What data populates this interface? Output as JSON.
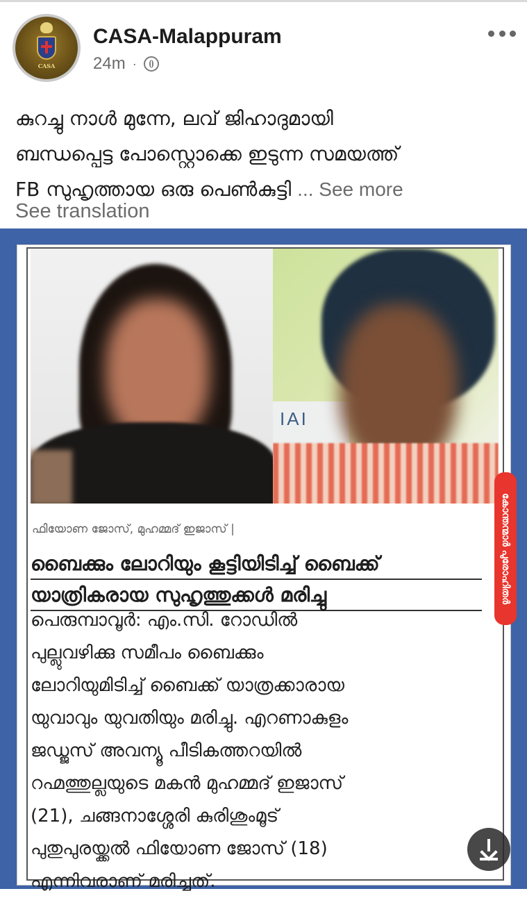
{
  "post": {
    "page_name": "CASA-Malappuram",
    "timestamp": "24m",
    "separator": "·",
    "avatar_text": "CASA",
    "text_line1": "കുറച്ചു നാൾ മുന്നേ, ലവ് ജിഹാദുമായി",
    "text_line2": "ബന്ധപ്പെട്ട പോസ്റ്റൊക്കെ ഇടുന്ന സമയത്ത്",
    "text_line3": "FB സുഹൃത്തായ ഒരു പെൺകുട്ടി",
    "see_more": "... See more",
    "see_translation": "See translation"
  },
  "clipping": {
    "photo_sign_text": "IAI",
    "caption": "ഫിയോണ ജോസ്, മുഹമ്മദ് ഇജാസ് |",
    "headline_line1": "ബൈക്കും ലോറിയും കൂട്ടിയിടിച്ച് ബൈക്ക്",
    "headline_line2": "യാത്രികരായ സുഹൃത്തുക്കൾ മരിച്ചു",
    "body_lines": [
      "പെരുമ്പാവൂർ: എം.സി. റോഡിൽ",
      "പുല്ലുവഴിക്കു സമീപം ബൈക്കും",
      "ലോറിയുമിടിച്ച് ബൈക്ക് യാത്രക്കാരായ",
      "യുവാവും യുവതിയും മരിച്ചു. എറണാകുളം",
      "ജഡ്ജസ് അവന്യൂ പീടികത്തറയിൽ",
      "റഹ്മത്തുല്ലയുടെ മകൻ മുഹമ്മദ് ഇജാസ്",
      "(21), ചങ്ങനാശ്ശേരി കുരിശുംമൂട്",
      "പുതുപുരയ്ക്കൽ ഫിയോണ ജോസ് (18)",
      "എന്നിവരാണ് മരിച്ചത്."
    ],
    "side_label": "കോന്തന്മാർ പുരോഹിതർ"
  },
  "icons": {
    "globe": "globe-icon",
    "more": "more-options-icon",
    "download": "download-icon"
  },
  "colors": {
    "frame_blue": "#3e63a6",
    "side_label_red": "#e8352d",
    "text_primary": "#1c1c1c",
    "text_secondary": "#6b6b6b"
  }
}
